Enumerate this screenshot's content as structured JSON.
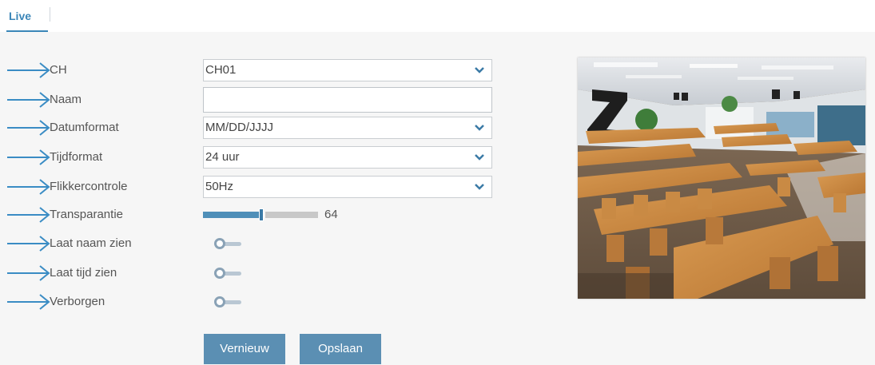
{
  "tabs": [
    {
      "label": "Live",
      "active": true
    }
  ],
  "form": {
    "channel": {
      "label": "CH",
      "value": "CH01"
    },
    "name": {
      "label": "Naam",
      "value": ""
    },
    "date_format": {
      "label": "Datumformat",
      "value": "MM/DD/JJJJ"
    },
    "time_format": {
      "label": "Tijdformat",
      "value": "24 uur"
    },
    "flicker": {
      "label": "Flikkercontrole",
      "value": "50Hz"
    },
    "transparency": {
      "label": "Transparantie",
      "value": "64",
      "level_fraction": 0.5
    },
    "show_name": {
      "label": "Laat naam zien",
      "enabled": false
    },
    "show_time": {
      "label": "Laat tijd zien",
      "enabled": false
    },
    "hidden": {
      "label": "Verborgen",
      "enabled": false
    }
  },
  "buttons": {
    "refresh": "Vernieuw",
    "save": "Opslaan"
  },
  "colors": {
    "accent": "#3b86b8",
    "button": "#5b8fb3",
    "arrow": "#3a8cc4"
  },
  "icons": {
    "row_marker": "arrow-right-icon",
    "dropdown": "chevron-down-icon"
  }
}
